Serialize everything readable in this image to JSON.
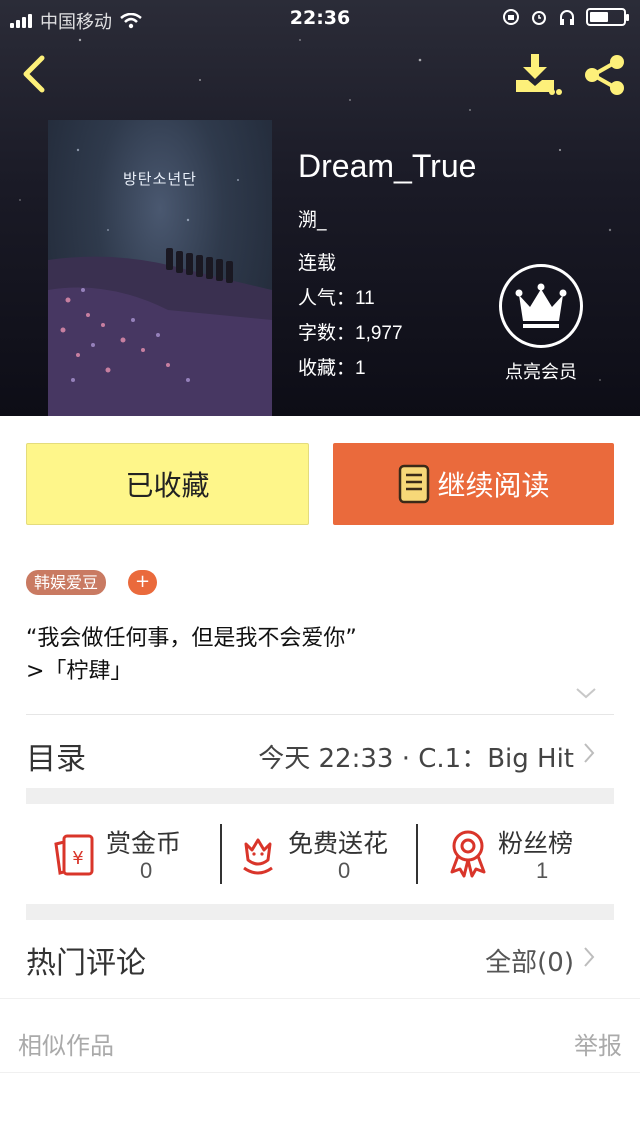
{
  "status_bar": {
    "carrier": "中国移动",
    "time": "22:36",
    "battery_level": 0.55
  },
  "nav": {
    "back_icon": "chevron-left-icon",
    "download_icon": "download-icon",
    "share_icon": "share-icon"
  },
  "book": {
    "cover_text": "방탄소년단",
    "title": "Dream_True",
    "author": "溯_",
    "status": "连载",
    "popularity_label": "人气：",
    "popularity": "11",
    "words_label": "字数：",
    "words": "1,977",
    "favorites_label": "收藏：",
    "favorites": "1"
  },
  "vip": {
    "icon": "crown-icon",
    "label": "点亮会员"
  },
  "actions": {
    "collected_label": "已收藏",
    "read_label": "继续阅读",
    "read_icon": "book-icon"
  },
  "tags": {
    "items": [
      "韩娱爱豆"
    ],
    "add_label": "+"
  },
  "intro": {
    "line1": "“我会做任何事，但是我不会爱你”",
    "line2": ">「柠肆」"
  },
  "toc": {
    "label": "目录",
    "latest": "今天 22:33 · C.1：Big Hit"
  },
  "rewards": [
    {
      "label": "赏金币",
      "value": "0",
      "icon": "red-envelope-icon"
    },
    {
      "label": "免费送花",
      "value": "0",
      "icon": "flower-icon"
    },
    {
      "label": "粉丝榜",
      "value": "1",
      "icon": "award-ribbon-icon"
    }
  ],
  "comments": {
    "label": "热门评论",
    "all_label": "全部(0)"
  },
  "footer": {
    "similar_label": "相似作品",
    "report_label": "举报"
  },
  "colors": {
    "accent_orange": "#ea6a3c",
    "icon_yellow": "#fdf07a",
    "collected_bg": "#fef68a",
    "tag_bg": "#c97a62",
    "icon_red": "#d9352a"
  }
}
